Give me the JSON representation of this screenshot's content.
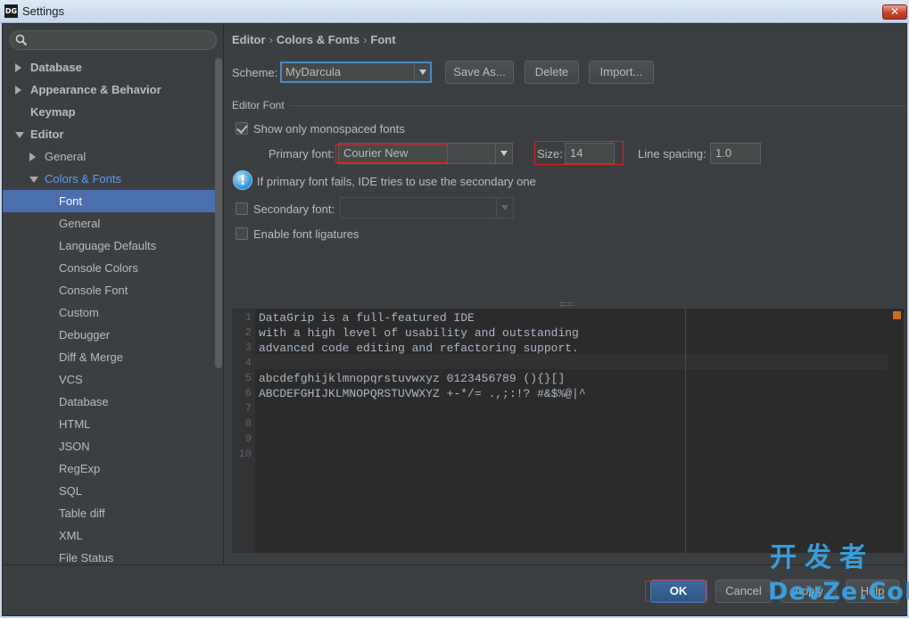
{
  "window": {
    "title": "Settings",
    "logo": "DG",
    "close_label": "✕"
  },
  "sidebar": {
    "search_placeholder": "",
    "items": [
      {
        "label": "Database",
        "level": 0,
        "bold": true,
        "arrow": "right"
      },
      {
        "label": "Appearance & Behavior",
        "level": 0,
        "bold": true,
        "arrow": "right"
      },
      {
        "label": "Keymap",
        "level": 0,
        "bold": true,
        "arrow": "none"
      },
      {
        "label": "Editor",
        "level": 0,
        "bold": true,
        "arrow": "down"
      },
      {
        "label": "General",
        "level": 1,
        "bold": false,
        "arrow": "right"
      },
      {
        "label": "Colors & Fonts",
        "level": 1,
        "bold": false,
        "arrow": "down",
        "highlight": true
      },
      {
        "label": "Font",
        "level": 2,
        "bold": false,
        "arrow": "none",
        "selected": true
      },
      {
        "label": "General",
        "level": 2,
        "bold": false,
        "arrow": "none"
      },
      {
        "label": "Language Defaults",
        "level": 2,
        "bold": false,
        "arrow": "none"
      },
      {
        "label": "Console Colors",
        "level": 2,
        "bold": false,
        "arrow": "none"
      },
      {
        "label": "Console Font",
        "level": 2,
        "bold": false,
        "arrow": "none"
      },
      {
        "label": "Custom",
        "level": 2,
        "bold": false,
        "arrow": "none"
      },
      {
        "label": "Debugger",
        "level": 2,
        "bold": false,
        "arrow": "none"
      },
      {
        "label": "Diff & Merge",
        "level": 2,
        "bold": false,
        "arrow": "none"
      },
      {
        "label": "VCS",
        "level": 2,
        "bold": false,
        "arrow": "none"
      },
      {
        "label": "Database",
        "level": 2,
        "bold": false,
        "arrow": "none"
      },
      {
        "label": "HTML",
        "level": 2,
        "bold": false,
        "arrow": "none"
      },
      {
        "label": "JSON",
        "level": 2,
        "bold": false,
        "arrow": "none"
      },
      {
        "label": "RegExp",
        "level": 2,
        "bold": false,
        "arrow": "none"
      },
      {
        "label": "SQL",
        "level": 2,
        "bold": false,
        "arrow": "none"
      },
      {
        "label": "Table diff",
        "level": 2,
        "bold": false,
        "arrow": "none"
      },
      {
        "label": "XML",
        "level": 2,
        "bold": false,
        "arrow": "none"
      },
      {
        "label": "File Status",
        "level": 2,
        "bold": false,
        "arrow": "none"
      }
    ]
  },
  "breadcrumb": {
    "part1": "Editor",
    "part2": "Colors & Fonts",
    "part3": "Font",
    "sep": "›"
  },
  "scheme": {
    "label": "Scheme:",
    "value": "MyDarcula",
    "save_as": "Save As...",
    "delete": "Delete",
    "import": "Import..."
  },
  "editor_font": {
    "section_title": "Editor Font",
    "monospaced_label": "Show only monospaced fonts",
    "monospaced_checked": true,
    "primary_label": "Primary font:",
    "primary_value": "Courier New",
    "size_label": "Size:",
    "size_value": "14",
    "spacing_label": "Line spacing:",
    "spacing_value": "1.0",
    "info_text": "If primary font fails, IDE tries to use the secondary one",
    "secondary_label": "Secondary font:",
    "secondary_value": "",
    "ligatures_label": "Enable font ligatures",
    "ligatures_checked": false
  },
  "preview": {
    "line_numbers": [
      "1",
      "2",
      "3",
      "4",
      "5",
      "6",
      "7",
      "8",
      "9",
      "10"
    ],
    "lines": [
      "DataGrip is a full-featured IDE",
      "with a high level of usability and outstanding",
      "advanced code editing and refactoring support.",
      "",
      "abcdefghijklmnopqrstuvwxyz 0123456789 (){}[]",
      "ABCDEFGHIJKLMNOPQRSTUVWXYZ +-*/= .,;:!? #&$%@|^",
      "",
      "",
      "",
      ""
    ]
  },
  "footer": {
    "ok": "OK",
    "cancel": "Cancel",
    "apply": "Apply",
    "help": "Help"
  },
  "watermark": {
    "top": "开发者",
    "bottom": "DevZe.CoM"
  },
  "colors": {
    "background": "#3c3f41",
    "selection": "#4b6eaf",
    "link": "#589df6",
    "highlight_box": "#e02020"
  }
}
